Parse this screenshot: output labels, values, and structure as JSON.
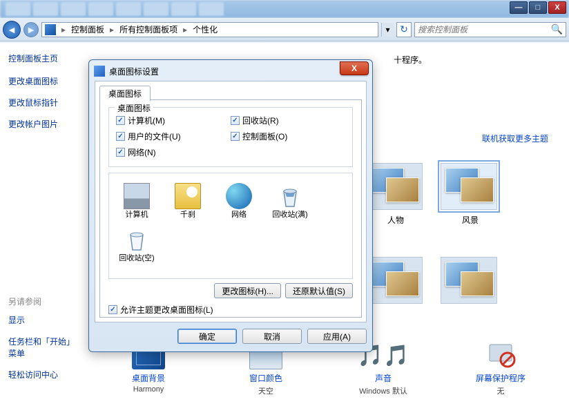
{
  "window_buttons": {
    "min": "—",
    "max": "□",
    "close": "X"
  },
  "breadcrumb": {
    "item1": "控制面板",
    "item2": "所有控制面板项",
    "item3": "个性化"
  },
  "search": {
    "placeholder": "搜索控制面板"
  },
  "sidebar": {
    "title": "控制面板主页",
    "links": [
      "更改桌面图标",
      "更改鼠标指针",
      "更改帐户图片"
    ],
    "see_also_label": "另请参阅",
    "see_also": [
      "显示",
      "任务栏和「开始」菜单",
      "轻松访问中心"
    ]
  },
  "main": {
    "instr_tail": "十程序。",
    "more_themes": "联机获取更多主题",
    "themes_r1": [
      "人物",
      "风景"
    ],
    "bottom": [
      {
        "label": "桌面背景",
        "value": "Harmony"
      },
      {
        "label": "窗口颜色",
        "value": "天空"
      },
      {
        "label": "声音",
        "value": "Windows 默认"
      },
      {
        "label": "屏幕保护程序",
        "value": "无"
      }
    ]
  },
  "dialog": {
    "title": "桌面图标设置",
    "tab": "桌面图标",
    "group_title": "桌面图标",
    "checks": [
      {
        "label": "计算机(M)",
        "on": true
      },
      {
        "label": "回收站(R)",
        "on": true
      },
      {
        "label": "用户的文件(U)",
        "on": true
      },
      {
        "label": "控制面板(O)",
        "on": true
      },
      {
        "label": "网络(N)",
        "on": true
      }
    ],
    "icons": [
      "计算机",
      "千刹",
      "网络",
      "回收站(满)",
      "回收站(空)"
    ],
    "change_icon": "更改图标(H)...",
    "restore": "还原默认值(S)",
    "allow_theme": "允许主题更改桌面图标(L)",
    "ok": "确定",
    "cancel": "取消",
    "apply": "应用(A)"
  }
}
